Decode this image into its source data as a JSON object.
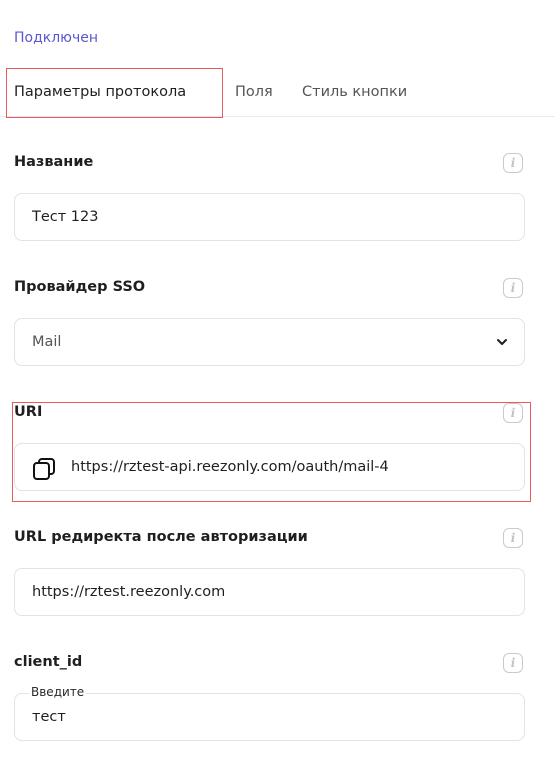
{
  "status": "Подключен",
  "tabs": [
    {
      "label": "Параметры протокола"
    },
    {
      "label": "Поля"
    },
    {
      "label": "Стиль кнопки"
    }
  ],
  "fields": {
    "name": {
      "label": "Название",
      "value": "Тест 123"
    },
    "sso_provider": {
      "label": "Провайдер SSO",
      "value": "Mail"
    },
    "uri": {
      "label": "URI",
      "value": "https://rztest-api.reezonly.com/oauth/mail-4"
    },
    "redirect_url": {
      "label": "URL редиректа после авторизации",
      "value": "https://rztest.reezonly.com"
    },
    "client_id": {
      "label": "client_id",
      "floating_label": "Введите",
      "value": "тест"
    }
  },
  "icons": {
    "info": "info-icon",
    "select": "chevron-down-icon",
    "copy": "copy-icon"
  },
  "colors": {
    "accent": "#5b57d1",
    "highlight": "#e65c5c",
    "border": "#e2e2e8"
  }
}
